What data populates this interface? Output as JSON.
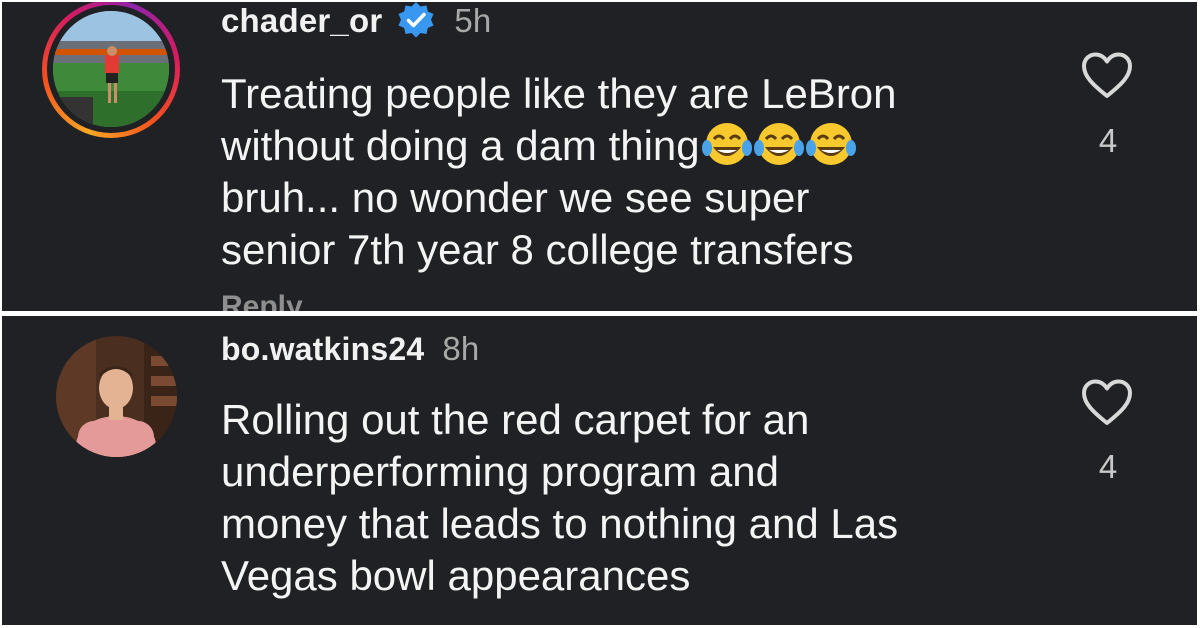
{
  "comments": [
    {
      "username": "chader_or",
      "verified": true,
      "time": "5h",
      "text_lines": [
        "Treating people like they are LeBron",
        "without doing a dam thing",
        "bruh... no wonder we see super",
        "senior 7th year 8 college transfers"
      ],
      "emoji": [
        "face-with-tears-of-joy",
        "face-with-tears-of-joy",
        "face-with-tears-of-joy"
      ],
      "likes": "4",
      "reply_label": "Reply"
    },
    {
      "username": "bo.watkins24",
      "verified": false,
      "time": "8h",
      "text_lines": [
        "Rolling out the red carpet for an",
        "underperforming program and",
        "money that leads to nothing and Las",
        "Vegas bowl appearances"
      ],
      "likes": "4"
    }
  ],
  "colors": {
    "background": "#202124",
    "text": "#f4f4f4",
    "muted": "#a8a8a8",
    "verified_badge": "#3897f0"
  },
  "icons": [
    "heart-outline-icon",
    "verified-badge-icon",
    "story-ring"
  ]
}
